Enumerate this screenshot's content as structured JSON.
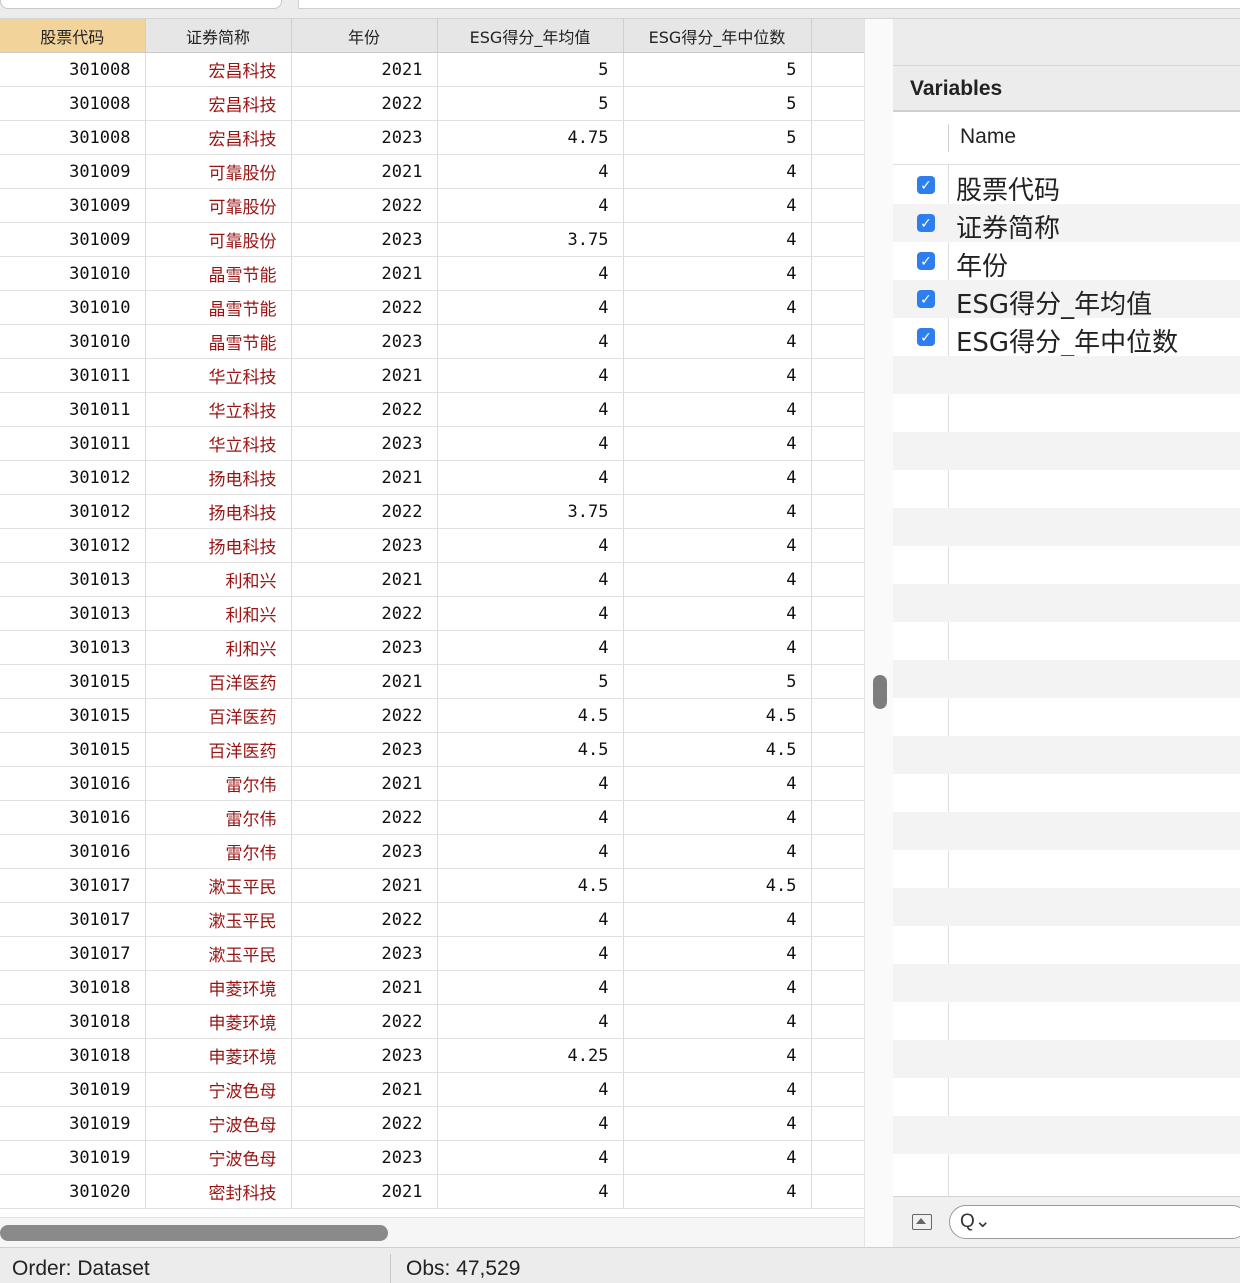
{
  "grid": {
    "columns": [
      "股票代码",
      "证券简称",
      "年份",
      "ESG得分_年均值",
      "ESG得分_年中位数"
    ],
    "rows": [
      [
        "301008",
        "宏昌科技",
        "2021",
        "5",
        "5"
      ],
      [
        "301008",
        "宏昌科技",
        "2022",
        "5",
        "5"
      ],
      [
        "301008",
        "宏昌科技",
        "2023",
        "4.75",
        "5"
      ],
      [
        "301009",
        "可靠股份",
        "2021",
        "4",
        "4"
      ],
      [
        "301009",
        "可靠股份",
        "2022",
        "4",
        "4"
      ],
      [
        "301009",
        "可靠股份",
        "2023",
        "3.75",
        "4"
      ],
      [
        "301010",
        "晶雪节能",
        "2021",
        "4",
        "4"
      ],
      [
        "301010",
        "晶雪节能",
        "2022",
        "4",
        "4"
      ],
      [
        "301010",
        "晶雪节能",
        "2023",
        "4",
        "4"
      ],
      [
        "301011",
        "华立科技",
        "2021",
        "4",
        "4"
      ],
      [
        "301011",
        "华立科技",
        "2022",
        "4",
        "4"
      ],
      [
        "301011",
        "华立科技",
        "2023",
        "4",
        "4"
      ],
      [
        "301012",
        "扬电科技",
        "2021",
        "4",
        "4"
      ],
      [
        "301012",
        "扬电科技",
        "2022",
        "3.75",
        "4"
      ],
      [
        "301012",
        "扬电科技",
        "2023",
        "4",
        "4"
      ],
      [
        "301013",
        "利和兴",
        "2021",
        "4",
        "4"
      ],
      [
        "301013",
        "利和兴",
        "2022",
        "4",
        "4"
      ],
      [
        "301013",
        "利和兴",
        "2023",
        "4",
        "4"
      ],
      [
        "301015",
        "百洋医药",
        "2021",
        "5",
        "5"
      ],
      [
        "301015",
        "百洋医药",
        "2022",
        "4.5",
        "4.5"
      ],
      [
        "301015",
        "百洋医药",
        "2023",
        "4.5",
        "4.5"
      ],
      [
        "301016",
        "雷尔伟",
        "2021",
        "4",
        "4"
      ],
      [
        "301016",
        "雷尔伟",
        "2022",
        "4",
        "4"
      ],
      [
        "301016",
        "雷尔伟",
        "2023",
        "4",
        "4"
      ],
      [
        "301017",
        "漱玉平民",
        "2021",
        "4.5",
        "4.5"
      ],
      [
        "301017",
        "漱玉平民",
        "2022",
        "4",
        "4"
      ],
      [
        "301017",
        "漱玉平民",
        "2023",
        "4",
        "4"
      ],
      [
        "301018",
        "申菱环境",
        "2021",
        "4",
        "4"
      ],
      [
        "301018",
        "申菱环境",
        "2022",
        "4",
        "4"
      ],
      [
        "301018",
        "申菱环境",
        "2023",
        "4.25",
        "4"
      ],
      [
        "301019",
        "宁波色母",
        "2021",
        "4",
        "4"
      ],
      [
        "301019",
        "宁波色母",
        "2022",
        "4",
        "4"
      ],
      [
        "301019",
        "宁波色母",
        "2023",
        "4",
        "4"
      ],
      [
        "301020",
        "密封科技",
        "2021",
        "4",
        "4"
      ]
    ]
  },
  "variables": {
    "title": "Variables",
    "name_header": "Name",
    "items": [
      "股票代码",
      "证券简称",
      "年份",
      "ESG得分_年均值",
      "ESG得分_年中位数"
    ],
    "checked": [
      true,
      true,
      true,
      true,
      true
    ],
    "search_glyph": "Q⌄"
  },
  "status": {
    "order": "Order: Dataset",
    "obs": "Obs: 47,529"
  },
  "colors": {
    "selected_header": "#f2d49b",
    "string_text": "#9a1313",
    "checkbox": "#2d7ff0"
  }
}
